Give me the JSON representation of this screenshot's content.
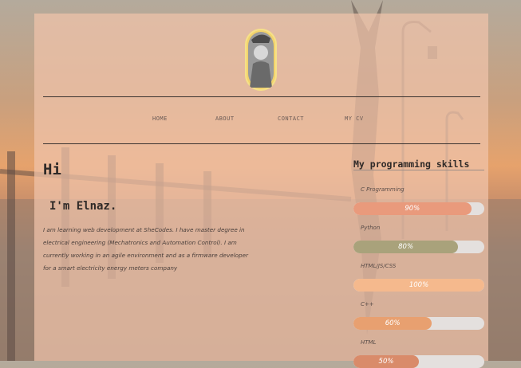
{
  "nav": {
    "home": "HOME",
    "about": "ABOUT",
    "contact": "CONTACT",
    "mycv": "MY CV"
  },
  "hero": {
    "greeting": "Hi",
    "name": "I'm Elnaz.",
    "bio": "I am learning web development at SheCodes. I have master degree in electrical engineering (Mechatronics and Automation Control). I am currently working in an agile environment and as a firmware developer for a smart electricity energy meters company"
  },
  "skills": {
    "title": "My programming skills",
    "items": [
      {
        "label": "C Programming",
        "percent_label": "90%",
        "value": 90,
        "color": "#e99a7c"
      },
      {
        "label": "Python",
        "percent_label": "80%",
        "value": 80,
        "color": "#a9a27b"
      },
      {
        "label": "HTML/JS/CSS",
        "percent_label": "100%",
        "value": 100,
        "color": "#f5b98d"
      },
      {
        "label": "C++",
        "percent_label": "60%",
        "value": 60,
        "color": "#e8a070"
      },
      {
        "label": "HTML",
        "percent_label": "50%",
        "value": 50,
        "color": "#d98b6a"
      }
    ]
  }
}
